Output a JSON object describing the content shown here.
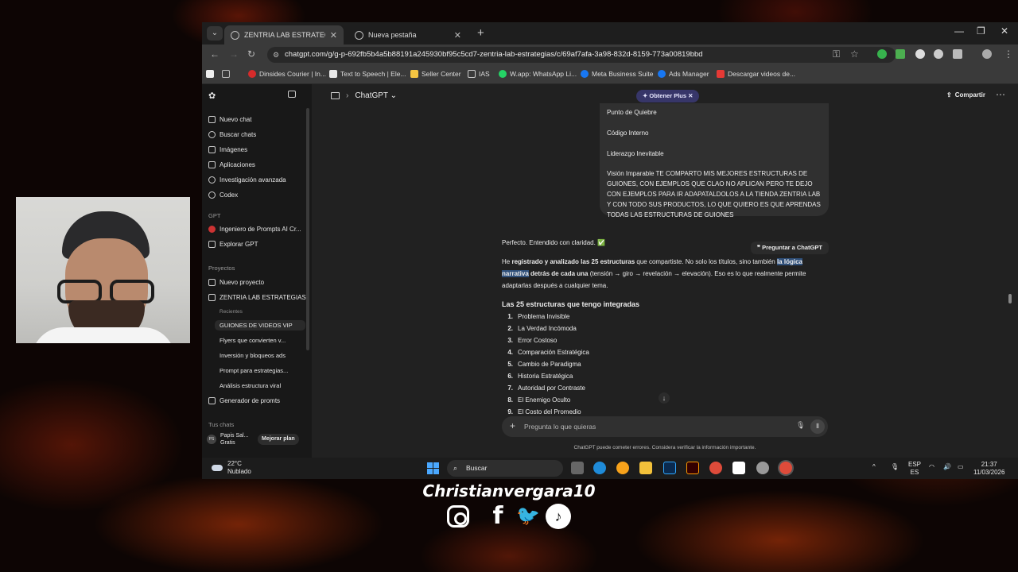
{
  "browser": {
    "tabs": [
      {
        "label": "ZENTRIA LAB ESTRATEGIAS - C",
        "active": true
      },
      {
        "label": "Nueva pestaña",
        "active": false
      }
    ],
    "url": "chatgpt.com/g/g-p-692fb5b4a5b88191a245930bf95c5cd7-zentria-lab-estrategias/c/69af7afa-3a98-832d-8159-773a00819bbd",
    "bookmarks": [
      {
        "label": "Dinsides Courier | In...",
        "color": "#d62b2b"
      },
      {
        "label": "Text to Speech | Ele...",
        "color": "#e8e8e8"
      },
      {
        "label": "Seller Center",
        "color": "#f5c542"
      },
      {
        "label": "IAS",
        "color": "folder"
      },
      {
        "label": "W.app: WhatsApp Li...",
        "color": "#25d366"
      },
      {
        "label": "Meta Business Suite",
        "color": "#1877f2"
      },
      {
        "label": "Ads Manager",
        "color": "#1877f2"
      },
      {
        "label": "Descargar videos de...",
        "color": "#e53935"
      }
    ]
  },
  "sidebar": {
    "nav": [
      {
        "label": "Nuevo chat",
        "icon": "edit-icon"
      },
      {
        "label": "Buscar chats",
        "icon": "search-icon"
      },
      {
        "label": "Imágenes",
        "icon": "image-icon"
      },
      {
        "label": "Aplicaciones",
        "icon": "apps-icon"
      },
      {
        "label": "Investigación avanzada",
        "icon": "research-icon"
      },
      {
        "label": "Codex",
        "icon": "codex-icon"
      }
    ],
    "gpt_header": "GPT",
    "gpts": [
      {
        "label": "Ingeniero de Prompts AI Cr..."
      },
      {
        "label": "Explorar GPT"
      }
    ],
    "projects_header": "Proyectos",
    "new_project": "Nuevo proyecto",
    "project_name": "ZENTRIA LAB ESTRATEGIAS",
    "recent_header": "Recientes",
    "recent_chats": [
      "GUIONES DE VIDEOS VIP",
      "Flyers que convierten v...",
      "Inversión y bloqueos ads",
      "Prompt para estrategias...",
      "Análisis estructura viral"
    ],
    "generator": "Generador de promts",
    "chats_header": "Tus chats",
    "user": {
      "initials": "PS",
      "name": "Papis Sal...",
      "plan": "Gratis"
    },
    "upgrade_label": "Mejorar plan"
  },
  "header": {
    "title": "ChatGPT",
    "plus_label": "Obtener Plus",
    "share_label": "Compartir"
  },
  "conversation": {
    "user_message": [
      "Punto de Quiebre",
      "Código Interno",
      "Liderazgo Inevitable",
      "Visión Imparable    TE COMPARTO MIS MEJORES ESTRUCTURAS DE GUIONES, CON EJEMPLOS QUE CLAO NO APLICAN PERO TE DEJO CON EJEMPLOS PARA IR ADAPATALDOLOS A LA TIENDA ZENTRIA LAB Y CON TODO SUS PRODUCTOS, LO QUE QUIERO ES QUE APRENDAS TODAS LAS ESTRUCTURAS DE GUIONES"
    ],
    "reply_intro": "Perfecto. Entendido con claridad. ✅",
    "ask_button": "Preguntar a ChatGPT",
    "reply_p": {
      "a": "He ",
      "b": "registrado y analizado las 25 estructuras",
      "c": " que compartiste. No solo los títulos, sino también ",
      "d": "la lógica narrativa",
      "e": " detrás de cada una",
      "f": " (tensión → giro → revelación → elevación). Eso es lo que realmente permite adaptarlas después a cualquier tema."
    },
    "list_title": "Las 25 estructuras que tengo integradas",
    "list": [
      "Problema Invisible",
      "La Verdad Incómoda",
      "Error Costoso",
      "Comparación Estratégica",
      "Cambio de Paradigma",
      "Historia Estratégica",
      "Autoridad por Contraste",
      "El Enemigo Oculto",
      "El Costo del Promedio"
    ]
  },
  "composer": {
    "placeholder": "Pregunta lo que quieras",
    "disclaimer": "ChatGPT puede cometer errores. Considera verificar la información importante."
  },
  "taskbar": {
    "temp": "22°C",
    "weather": "Nublado",
    "search": "Buscar",
    "lang_1": "ESP",
    "lang_2": "ES",
    "time": "21:37",
    "date": "11/03/2026"
  },
  "overlay": {
    "handle": "Christianvergara10",
    "socials": [
      "instagram-icon",
      "facebook-icon",
      "twitter-icon",
      "tiktok-icon"
    ]
  }
}
